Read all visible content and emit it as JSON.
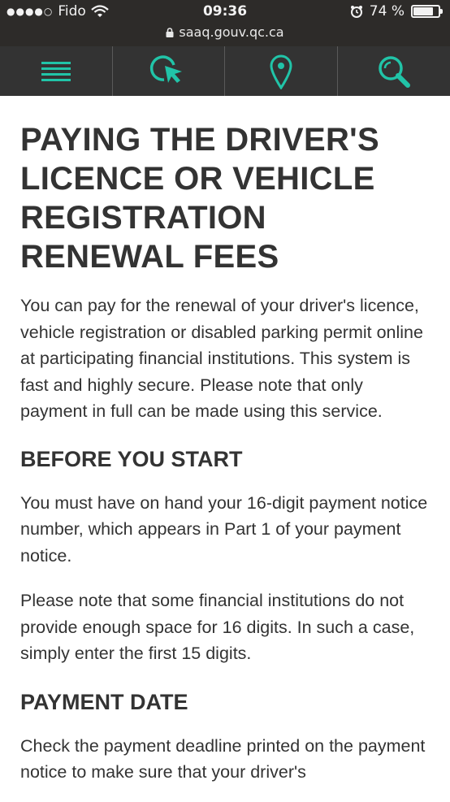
{
  "status_bar": {
    "carrier": "Fido",
    "time": "09:36",
    "battery": "74 %",
    "battery_level": 0.74,
    "url": "saaq.gouv.qc.ca"
  },
  "nav": {
    "accent_color": "#21c4a8",
    "items": [
      {
        "icon": "hamburger-menu-icon"
      },
      {
        "icon": "online-services-cursor-icon"
      },
      {
        "icon": "location-pin-icon"
      },
      {
        "icon": "search-icon"
      }
    ]
  },
  "page": {
    "title": "PAYING THE DRIVER'S LICENCE OR VEHICLE REGISTRATION RENEWAL FEES",
    "intro": "You can pay for the renewal of your driver's licence, vehicle registration or disabled parking permit online at participating financial institutions. This system is fast and highly secure. Please note that only payment in full can be made using this service.",
    "before_heading": "BEFORE YOU START",
    "before_p1": "You must have on hand your 16-digit payment notice number, which appears in Part 1 of your payment notice.",
    "before_p2": "Please note that some financial institutions do not provide enough space for 16 digits. In such a case, simply enter the first 15 digits.",
    "date_heading": "PAYMENT DATE",
    "date_p1": "Check the payment deadline printed on the payment notice to make sure that your driver's"
  }
}
